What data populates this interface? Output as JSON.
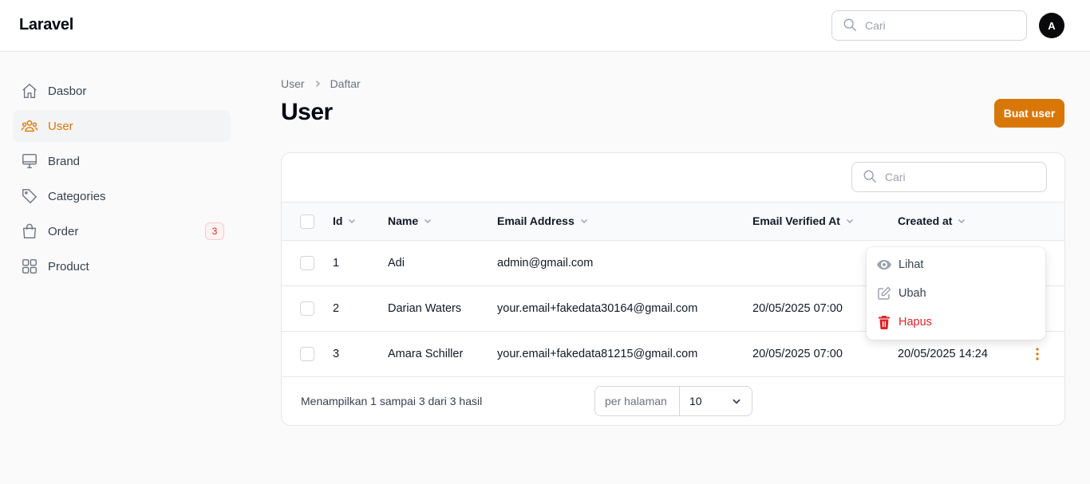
{
  "app": {
    "title": "Laravel"
  },
  "header": {
    "search_placeholder": "Cari",
    "avatar_initial": "A"
  },
  "sidebar": {
    "items": [
      {
        "label": "Dasbor",
        "icon": "home-icon",
        "active": false
      },
      {
        "label": "User",
        "icon": "users-icon",
        "active": true
      },
      {
        "label": "Brand",
        "icon": "monitor-icon",
        "active": false
      },
      {
        "label": "Categories",
        "icon": "tag-icon",
        "active": false
      },
      {
        "label": "Order",
        "icon": "shopping-bag-icon",
        "active": false,
        "badge": "3"
      },
      {
        "label": "Product",
        "icon": "grid-icon",
        "active": false
      }
    ]
  },
  "breadcrumb": [
    "User",
    "Daftar"
  ],
  "page": {
    "title": "User",
    "create_button": "Buat user"
  },
  "table": {
    "search_placeholder": "Cari",
    "columns": [
      "Id",
      "Name",
      "Email Address",
      "Email Verified At",
      "Created at"
    ],
    "rows": [
      {
        "id": "1",
        "name": "Adi",
        "email": "admin@gmail.com",
        "verified_at": "",
        "created_at": ""
      },
      {
        "id": "2",
        "name": "Darian Waters",
        "email": "your.email+fakedata30164@gmail.com",
        "verified_at": "20/05/2025 07:00",
        "created_at": ""
      },
      {
        "id": "3",
        "name": "Amara Schiller",
        "email": "your.email+fakedata81215@gmail.com",
        "verified_at": "20/05/2025 07:00",
        "created_at": "20/05/2025 14:24"
      }
    ],
    "footer": {
      "summary": "Menampilkan 1 sampai 3 dari 3 hasil",
      "per_page_label": "per halaman",
      "per_page_value": "10"
    }
  },
  "row_menu": {
    "items": [
      {
        "label": "Lihat",
        "icon": "eye-icon"
      },
      {
        "label": "Ubah",
        "icon": "pencil-square-icon"
      },
      {
        "label": "Hapus",
        "icon": "trash-icon"
      }
    ]
  },
  "colors": {
    "accent": "#d97706",
    "danger": "#dc2626",
    "muted": "#9ca3af"
  }
}
